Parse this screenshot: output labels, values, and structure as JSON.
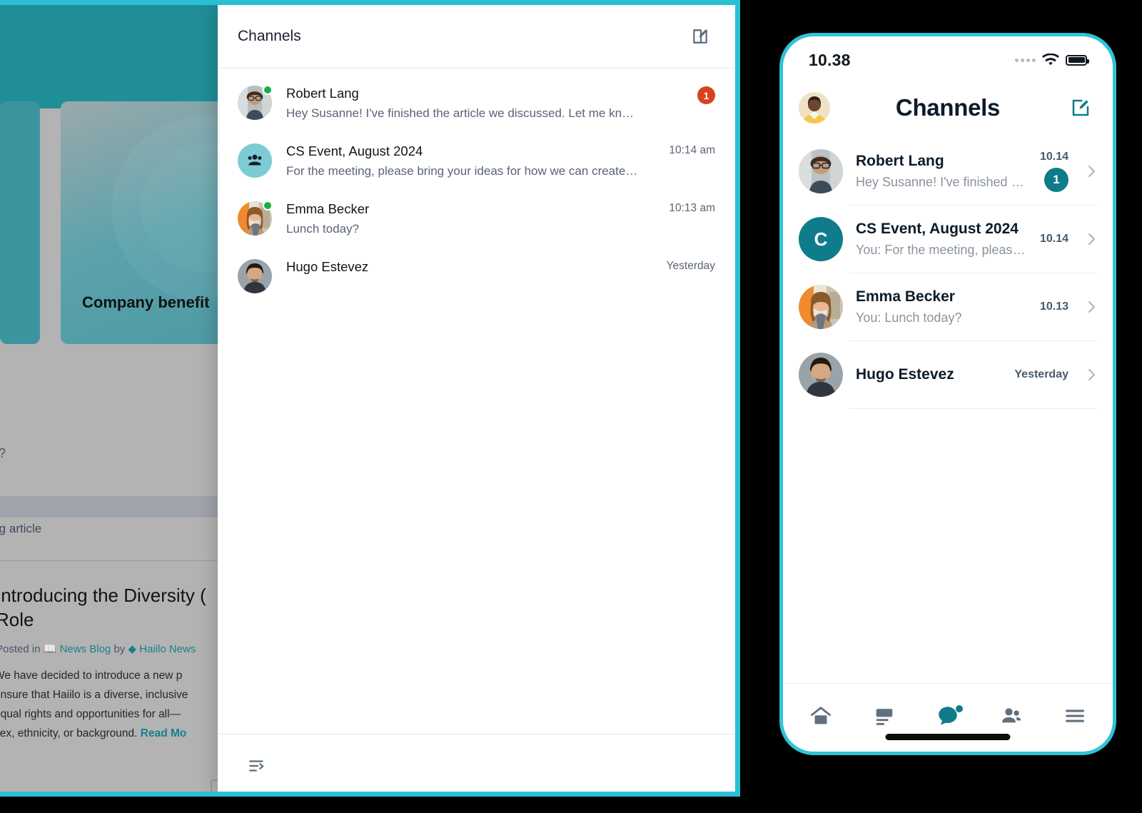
{
  "desktop": {
    "background_page": {
      "card_title": "Company benefit",
      "fragment_question": "n?",
      "fragment_blog": "blog article",
      "headline": "Introducing the Diversity ( Role",
      "headline_line1": "Introducing the Diversity (",
      "headline_line2": "Role",
      "posted_prefix": "Posted in",
      "posted_channel": "News Blog",
      "posted_by": "by",
      "posted_author": "Haiilo News",
      "body_line1": "We have decided to introduce a new p",
      "body_line2": "ensure that Haiilo is a diverse, inclusive",
      "body_line3": "equal rights and opportunities for all—",
      "body_line4": "sex, ethnicity, or background.",
      "read_more": "Read Mo"
    },
    "panel": {
      "title": "Channels",
      "compose_icon": "compose-icon",
      "collapse_icon": "collapse-sidebar-icon",
      "rows": [
        {
          "name": "Robert Lang",
          "preview": "Hey Susanne! I've finished the article we discussed. Let me know what you think",
          "time": "",
          "badge": "1",
          "online": true,
          "avatar": "robert-lang-avatar",
          "type": "person"
        },
        {
          "name": "CS Event, August 2024",
          "preview": "For the meeting, please bring your ideas for how we can create an amazing eve...",
          "time": "10:14 am",
          "badge": "",
          "online": false,
          "avatar": "group-avatar",
          "type": "group"
        },
        {
          "name": "Emma Becker",
          "preview": "Lunch today?",
          "time": "10:13 am",
          "badge": "",
          "online": true,
          "avatar": "emma-becker-avatar",
          "type": "person"
        },
        {
          "name": "Hugo Estevez",
          "preview": "",
          "time": "Yesterday",
          "badge": "",
          "online": false,
          "avatar": "hugo-estevez-avatar",
          "type": "person"
        }
      ]
    }
  },
  "phone": {
    "status_bar": {
      "time": "10.38",
      "signal_icon": "signal-dots-icon",
      "wifi_icon": "wifi-icon",
      "battery_icon": "battery-icon"
    },
    "header": {
      "title": "Channels",
      "avatar_icon": "user-avatar",
      "compose_icon": "compose-icon"
    },
    "rows": [
      {
        "name": "Robert Lang",
        "preview": "Hey Susanne! I've finished the article…",
        "time": "10.14",
        "badge": "1",
        "avatar": "robert-lang-avatar",
        "type": "person",
        "initial": ""
      },
      {
        "name": "CS Event, August 2024",
        "preview": "You: For the meeting, please bring yo…",
        "time": "10.14",
        "badge": "",
        "avatar": "group-initial-avatar",
        "type": "initial",
        "initial": "C"
      },
      {
        "name": "Emma Becker",
        "preview": "You: Lunch today?",
        "time": "10.13",
        "badge": "",
        "avatar": "emma-becker-avatar",
        "type": "person",
        "initial": ""
      },
      {
        "name": "Hugo Estevez",
        "preview": "",
        "time": "Yesterday",
        "badge": "",
        "avatar": "hugo-estevez-avatar",
        "type": "person",
        "initial": ""
      }
    ],
    "tabbar": [
      {
        "icon": "home-icon",
        "active": false,
        "dot": false
      },
      {
        "icon": "news-feed-icon",
        "active": false,
        "dot": false
      },
      {
        "icon": "chat-bubble-icon",
        "active": true,
        "dot": true
      },
      {
        "icon": "people-icon",
        "active": false,
        "dot": false
      },
      {
        "icon": "hamburger-menu-icon",
        "active": false,
        "dot": false
      }
    ]
  },
  "colors": {
    "frame_accent": "#2ec4d8",
    "brand_teal": "#0e7c8b",
    "badge_red": "#d8421f",
    "online_green": "#1aaf45",
    "group_avatar_bg": "#7ecbd6"
  }
}
